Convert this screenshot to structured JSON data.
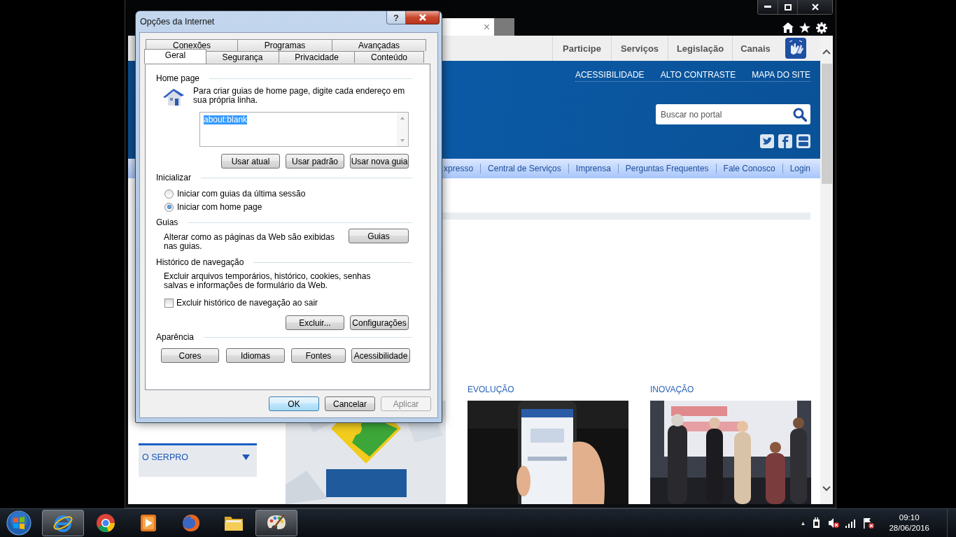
{
  "browser": {
    "tab": {
      "close": "×"
    },
    "page": {
      "top_nav": [
        "Participe",
        "Serviços",
        "Legislação",
        "Canais"
      ],
      "header_links": [
        "ACESSIBILIDADE",
        "ALTO CONTRASTE",
        "MAPA DO SITE"
      ],
      "search": {
        "placeholder": "Buscar no portal"
      },
      "main_nav": [
        "xpresso",
        "Central de Serviços",
        "Imprensa",
        "Perguntas Frequentes",
        "Fale Conosco",
        "Login"
      ],
      "sidebar": {
        "title": "O SERPRO",
        "expanded": false
      },
      "sections": [
        {
          "kind": "picture"
        },
        {
          "title": "EVOLUÇÃO",
          "kind": "picture"
        },
        {
          "title": "INOVAÇÃO",
          "kind": "picture"
        }
      ]
    }
  },
  "dialog": {
    "title": "Opções da Internet",
    "help": "?",
    "tab_rows": [
      [
        {
          "label": "Conexões",
          "selected": false
        },
        {
          "label": "Programas",
          "selected": false
        },
        {
          "label": "Avançadas",
          "selected": false
        }
      ],
      [
        {
          "label": "Geral",
          "selected": true
        },
        {
          "label": "Segurança",
          "selected": false
        },
        {
          "label": "Privacidade",
          "selected": false
        },
        {
          "label": "Conteúdo",
          "selected": false
        }
      ]
    ],
    "home_page": {
      "heading": "Home page",
      "text": "Para criar guias de home page, digite cada endereço em sua própria linha.",
      "value": "about:blank",
      "buttons": [
        "Usar atual",
        "Usar padrão",
        "Usar nova guia"
      ]
    },
    "startup": {
      "heading": "Inicializar",
      "options": [
        {
          "label": "Iniciar com guias da última sessão",
          "selected": false
        },
        {
          "label": "Iniciar com home page",
          "selected": true
        }
      ]
    },
    "tabs_group": {
      "heading": "Guias",
      "text": "Alterar como as páginas da Web são exibidas nas guias.",
      "button": "Guias"
    },
    "history": {
      "heading": "Histórico de navegação",
      "text": "Excluir arquivos temporários, histórico, cookies, senhas salvas e informações de formulário da Web.",
      "checkbox": {
        "label": "Excluir histórico de navegação ao sair",
        "checked": false
      },
      "buttons": [
        "Excluir...",
        "Configurações"
      ]
    },
    "appearance": {
      "heading": "Aparência",
      "buttons": [
        "Cores",
        "Idiomas",
        "Fontes",
        "Acessibilidade"
      ]
    },
    "footer_buttons": [
      {
        "label": "OK",
        "default": true,
        "disabled": false
      },
      {
        "label": "Cancelar",
        "default": false,
        "disabled": false
      },
      {
        "label": "Aplicar",
        "default": false,
        "disabled": true
      }
    ]
  },
  "taskbar": {
    "apps": [
      {
        "kind": "ie",
        "running": true
      },
      {
        "kind": "chrome",
        "running": false
      },
      {
        "kind": "media",
        "running": false
      },
      {
        "kind": "firefox",
        "running": false
      },
      {
        "kind": "folder",
        "running": false
      },
      {
        "kind": "paint",
        "running": true
      }
    ],
    "tray": {
      "overflow": "▲",
      "time": "09:10",
      "date": "28/06/2016"
    }
  }
}
